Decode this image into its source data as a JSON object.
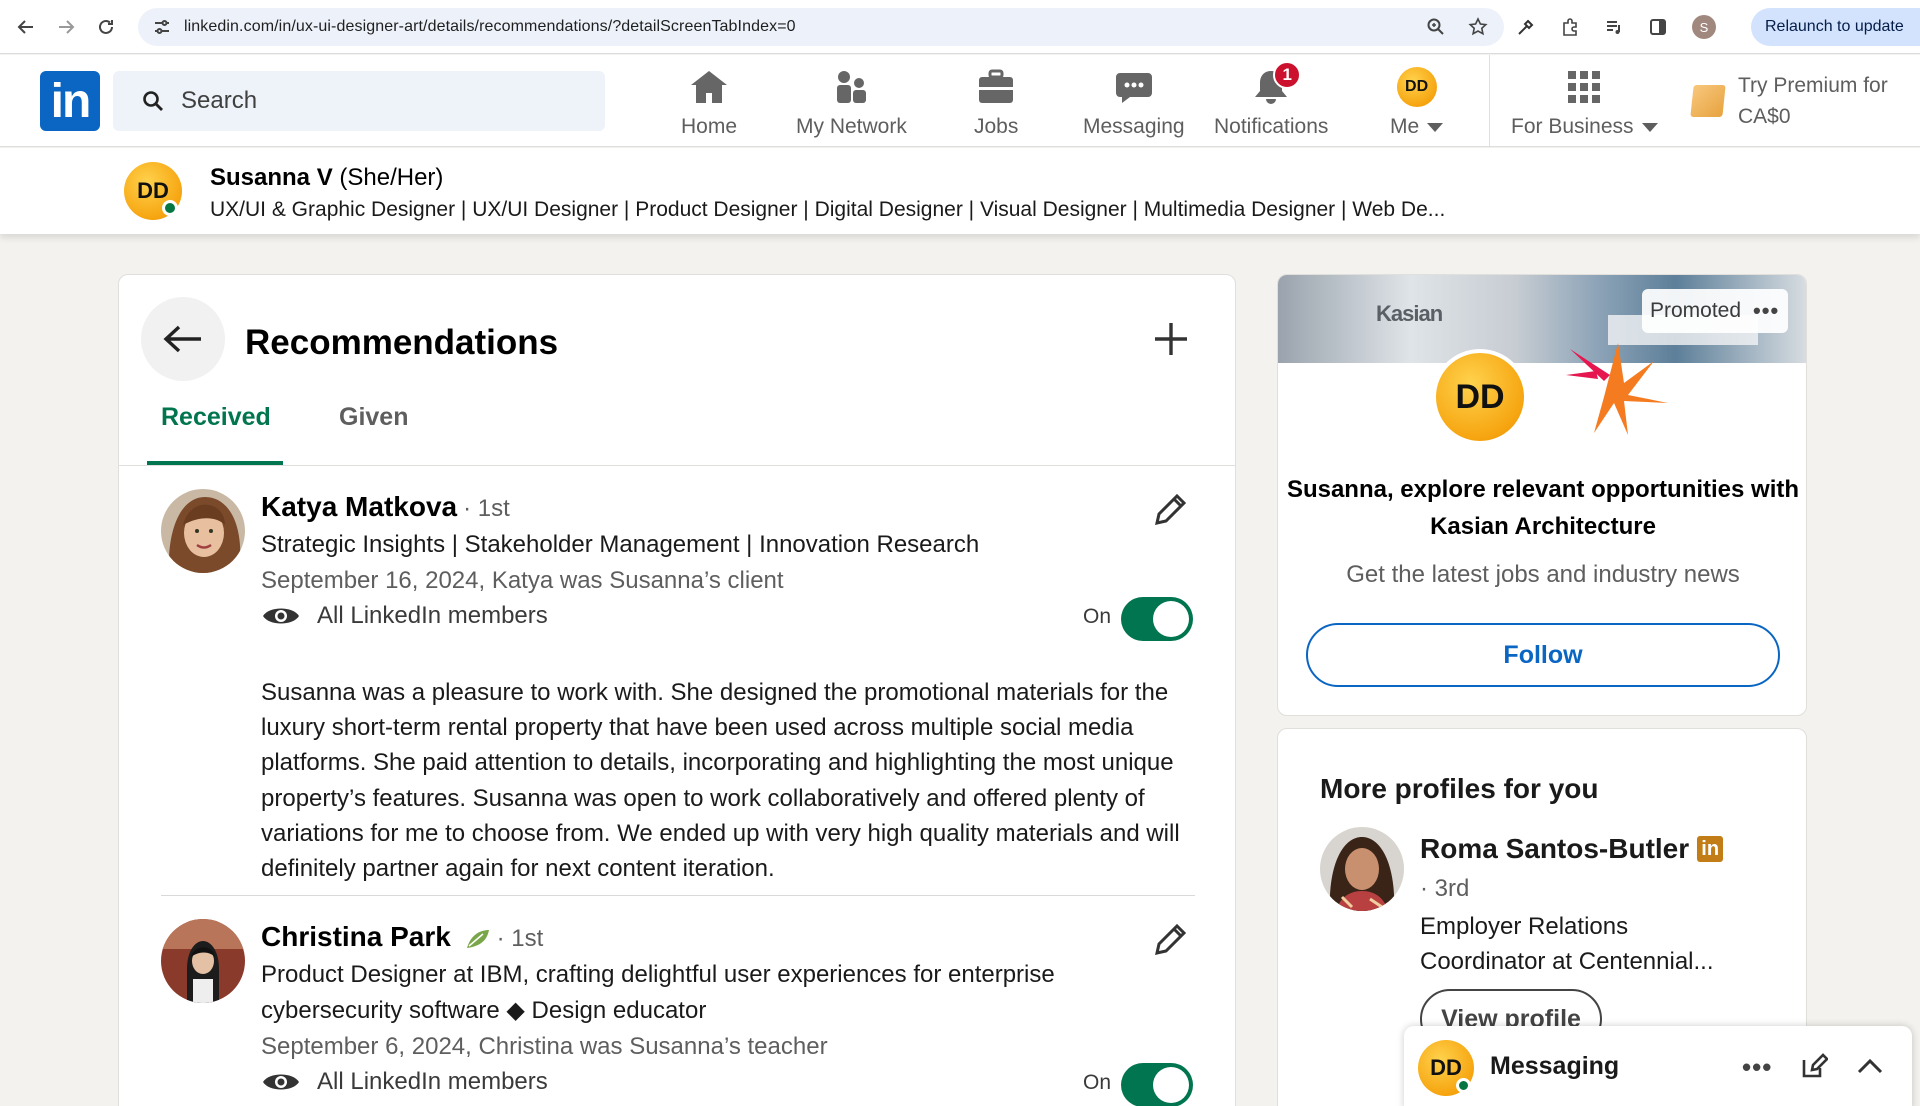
{
  "browser": {
    "url": "linkedin.com/in/ux-ui-designer-art/details/recommendations/?detailScreenTabIndex=0",
    "relaunch_label": "Relaunch to update",
    "profile_initial": "S"
  },
  "header": {
    "logo_text": "in",
    "search_placeholder": "Search",
    "nav": {
      "home": "Home",
      "network": "My Network",
      "jobs": "Jobs",
      "messaging": "Messaging",
      "notifications": "Notifications",
      "notifications_count": "1",
      "me": "Me",
      "business": "For Business"
    },
    "premium_line1": "Try Premium for",
    "premium_line2": "CA$0"
  },
  "profile": {
    "name": "Susanna V",
    "pronouns": "(She/Her)",
    "headline": "UX/UI & Graphic Designer | UX/UI Designer | Product Designer | Digital Designer | Visual Designer | Multimedia Designer | Web De..."
  },
  "recommendations": {
    "title": "Recommendations",
    "tabs": {
      "received": "Received",
      "given": "Given"
    },
    "items": [
      {
        "name": "Katya Matkova",
        "degree": "· 1st",
        "headline": "Strategic Insights | Stakeholder Management | Innovation Research",
        "date": "September 16, 2024, Katya was Susanna’s client",
        "visibility": "All LinkedIn members",
        "toggle_label": "On",
        "toggle_on": true,
        "text": "Susanna was a pleasure to work with. She designed the promotional materials for the luxury short-term rental property that have been used across multiple social media platforms. She paid attention to details, incorporating and highlighting the most unique property’s features. Susanna was open to work collaboratively and offered plenty of variations for me to choose from. We ended up with very high quality materials and will definitely partner again for next content iteration."
      },
      {
        "name": "Christina Park",
        "degree": "· 1st",
        "headline": "Product Designer at IBM, crafting delightful user experiences for enterprise cybersecurity software ◆ Design educator",
        "date": "September 6, 2024, Christina was Susanna’s teacher",
        "visibility": "All LinkedIn members",
        "toggle_label": "On",
        "toggle_on": true
      }
    ]
  },
  "ad": {
    "banner_text": "Kasian",
    "promoted_label": "Promoted",
    "headline": "Susanna, explore relevant opportunities with Kasian Architecture",
    "subtext": "Get the latest jobs and industry news",
    "follow_label": "Follow",
    "accent_color": "#0a66c2"
  },
  "more_profiles": {
    "title": "More profiles for you",
    "items": [
      {
        "name": "Roma Santos-Butler",
        "degree": "· 3rd",
        "role": "Employer Relations Coordinator at Centennial...",
        "button_label": "View profile"
      }
    ]
  },
  "messaging_dock": {
    "label": "Messaging"
  },
  "icons": [
    "back-arrow-icon",
    "reload-icon",
    "tune-icon",
    "zoom-icon",
    "star-icon",
    "extension-icon",
    "search-icon",
    "home-icon",
    "network-icon",
    "jobs-icon",
    "messaging-icon",
    "bell-icon",
    "grid-icon",
    "plus-icon",
    "pencil-icon",
    "eye-icon",
    "compose-icon",
    "chevron-up-icon"
  ],
  "colors": {
    "linkedin_blue": "#0a66c2",
    "green": "#01754f",
    "notification_red": "#cb112d"
  }
}
